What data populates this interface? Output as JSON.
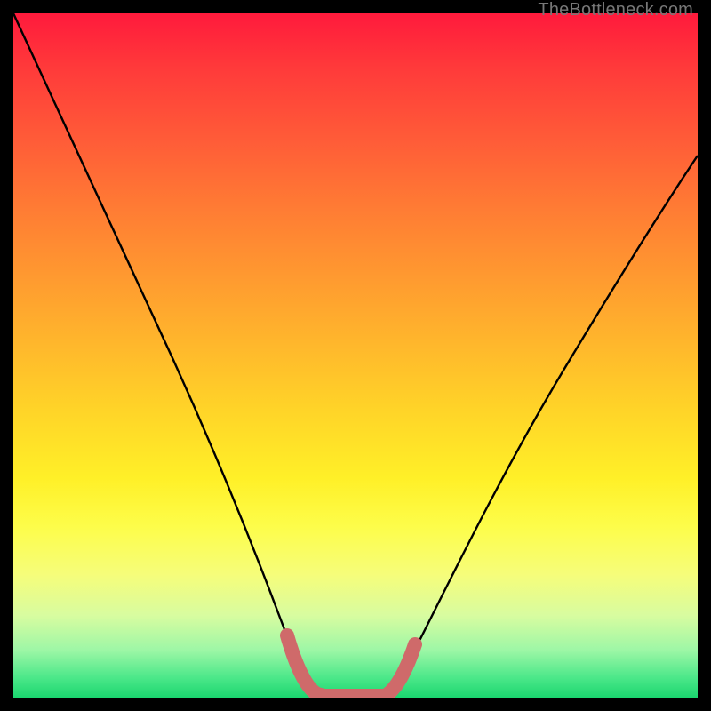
{
  "watermark": "TheBottleneck.com",
  "chart_data": {
    "type": "line",
    "title": "",
    "xlabel": "",
    "ylabel": "",
    "xlim": [
      0,
      100
    ],
    "ylim": [
      0,
      100
    ],
    "gradient_background": {
      "top_color": "#ff1a3c",
      "mid_color": "#fff028",
      "bottom_color": "#1bd66f",
      "meaning": "red=high bottleneck, green=low bottleneck"
    },
    "series": [
      {
        "name": "bottleneck-curve",
        "color": "#000000",
        "x": [
          0,
          5,
          10,
          15,
          20,
          25,
          30,
          35,
          38,
          40,
          43,
          46,
          49,
          52,
          55,
          58,
          62,
          68,
          75,
          82,
          90,
          100
        ],
        "values": [
          100,
          90,
          78,
          66,
          54,
          42,
          30,
          18,
          10,
          4,
          0,
          0,
          0,
          0,
          4,
          10,
          18,
          28,
          40,
          52,
          64,
          78
        ]
      },
      {
        "name": "optimal-band-highlight",
        "color": "#d46a6a",
        "x": [
          40,
          43,
          46,
          49,
          52,
          55
        ],
        "values": [
          4,
          0,
          0,
          0,
          0,
          4
        ]
      }
    ],
    "annotations": []
  }
}
